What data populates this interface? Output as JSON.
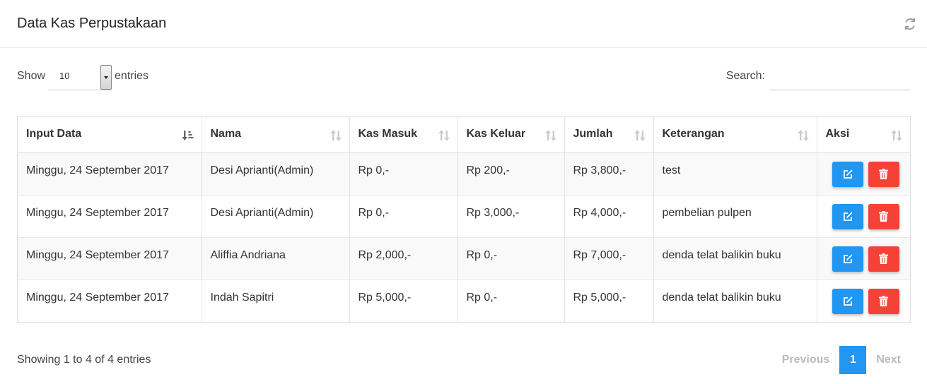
{
  "header": {
    "title": "Data Kas Perpustakaan",
    "refresh_icon": "refresh-icon"
  },
  "length": {
    "show_label": "Show",
    "value": "10",
    "entries_label": "entries"
  },
  "search": {
    "label": "Search:",
    "value": "",
    "placeholder": ""
  },
  "table": {
    "columns": [
      "Input Data",
      "Nama",
      "Kas Masuk",
      "Kas Keluar",
      "Jumlah",
      "Keterangan",
      "Aksi"
    ],
    "rows": [
      {
        "input_data": "Minggu, 24 September 2017",
        "nama": "Desi Aprianti(Admin)",
        "kas_masuk": "Rp 0,-",
        "kas_keluar": "Rp 200,-",
        "jumlah": "Rp 3,800,-",
        "keterangan": "test"
      },
      {
        "input_data": "Minggu, 24 September 2017",
        "nama": "Desi Aprianti(Admin)",
        "kas_masuk": "Rp 0,-",
        "kas_keluar": "Rp 3,000,-",
        "jumlah": "Rp 4,000,-",
        "keterangan": "pembelian pulpen"
      },
      {
        "input_data": "Minggu, 24 September 2017",
        "nama": "Aliffia Andriana",
        "kas_masuk": "Rp 2,000,-",
        "kas_keluar": "Rp 0,-",
        "jumlah": "Rp 7,000,-",
        "keterangan": "denda telat balikin buku"
      },
      {
        "input_data": "Minggu, 24 September 2017",
        "nama": "Indah Sapitri",
        "kas_masuk": "Rp 5,000,-",
        "kas_keluar": "Rp 0,-",
        "jumlah": "Rp 5,000,-",
        "keterangan": "denda telat balikin buku"
      }
    ]
  },
  "footer": {
    "info": "Showing 1 to 4 of 4 entries",
    "previous": "Previous",
    "current_page": "1",
    "next": "Next"
  },
  "colors": {
    "primary": "#2196f3",
    "danger": "#f44336",
    "disabled": "#bbbbbb"
  }
}
